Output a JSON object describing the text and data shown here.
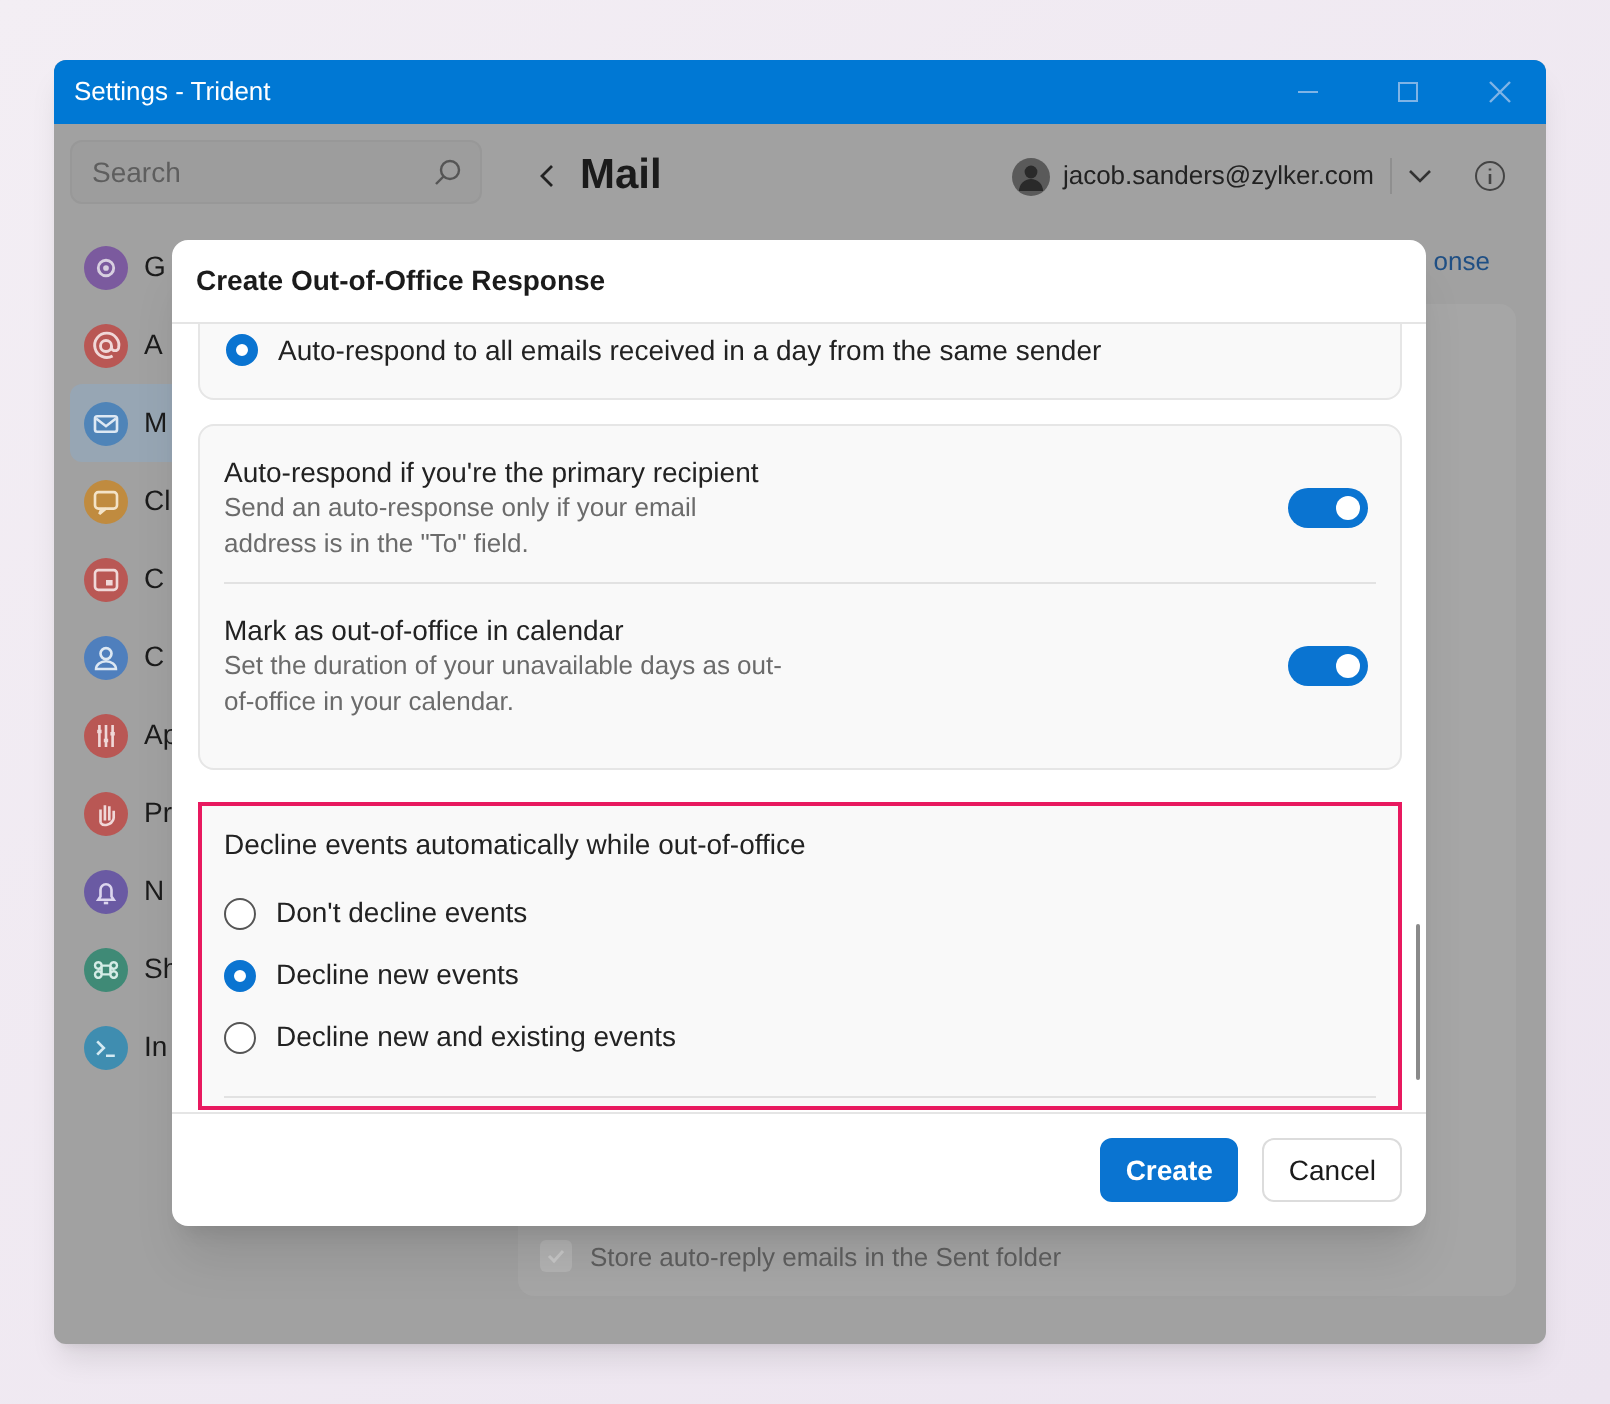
{
  "window": {
    "title": "Settings - Trident"
  },
  "search": {
    "placeholder": "Search"
  },
  "sidebar": {
    "items": [
      {
        "label": "G",
        "color": "#7b5a9e",
        "kind": "gear",
        "selected": false
      },
      {
        "label": "A",
        "color": "#b95754",
        "kind": "at",
        "selected": false
      },
      {
        "label": "M",
        "color": "#4f84b8",
        "kind": "mail",
        "selected": true
      },
      {
        "label": "Cl",
        "color": "#c08b3f",
        "kind": "chat",
        "selected": false
      },
      {
        "label": "C",
        "color": "#b95754",
        "kind": "calendar",
        "selected": false
      },
      {
        "label": "C",
        "color": "#4f7fbd",
        "kind": "person",
        "selected": false
      },
      {
        "label": "Ap",
        "color": "#b95754",
        "kind": "sliders",
        "selected": false
      },
      {
        "label": "Pr",
        "color": "#b95754",
        "kind": "hand",
        "selected": false
      },
      {
        "label": "N",
        "color": "#6a5aa3",
        "kind": "bell",
        "selected": false
      },
      {
        "label": "Sh",
        "color": "#3f8a76",
        "kind": "command",
        "selected": false
      },
      {
        "label": "In",
        "color": "#3f8db0",
        "kind": "terminal",
        "selected": false
      }
    ]
  },
  "header": {
    "title": "Mail",
    "account": "jacob.sanders@zylker.com"
  },
  "link_fragment": "onse",
  "background_option": {
    "label": "Store auto-reply emails in the Sent folder",
    "checked": true
  },
  "dialog": {
    "title": "Create Out-of-Office Response",
    "top_option": {
      "label": "Auto-respond to all emails received in a day from the same sender",
      "selected": true
    },
    "toggles": [
      {
        "title": "Auto-respond if you're the primary recipient",
        "description": "Send an auto-response only if your email address is in the \"To\" field.",
        "on": true
      },
      {
        "title": "Mark as out-of-office in calendar",
        "description": "Set the duration of your unavailable days as out-of-office in your calendar.",
        "on": true
      }
    ],
    "decline_group": {
      "title": "Decline events automatically while out-of-office",
      "options": [
        {
          "label": "Don't decline events",
          "selected": false
        },
        {
          "label": "Decline new events",
          "selected": true
        },
        {
          "label": "Decline new and existing events",
          "selected": false
        }
      ]
    },
    "buttons": [
      {
        "label": "Create",
        "kind": "primary"
      },
      {
        "label": "Cancel",
        "kind": "secondary"
      }
    ]
  }
}
